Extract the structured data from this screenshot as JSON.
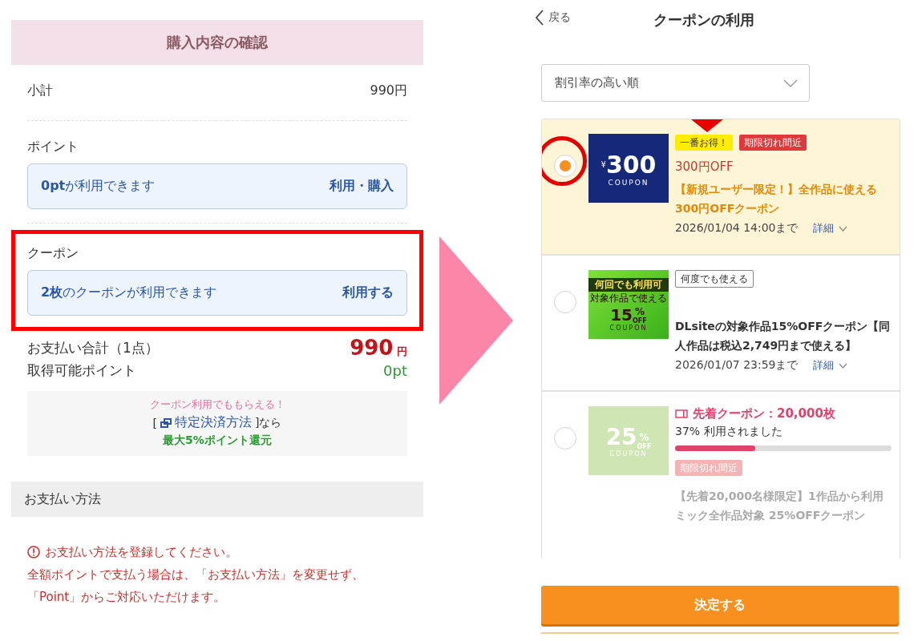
{
  "checkout": {
    "title": "購入内容の確認",
    "subtotal": {
      "label": "小計",
      "value": "990円"
    },
    "points": {
      "label": "ポイント",
      "text": "**0pt**が利用できます",
      "action": "利用・購入"
    },
    "coupon": {
      "label": "クーポン",
      "text": "**2枚**のクーポンが利用できます",
      "action": "利用する",
      "highlighted": true
    },
    "total": {
      "label": "お支払い合計（1点）",
      "amount": "990",
      "unit": "円"
    },
    "earn": {
      "label": "取得可能ポイント",
      "value": "0pt"
    },
    "promo": {
      "headline": "クーポン利用でももらえる！",
      "open": "[",
      "link": "特定決済方法",
      "close": "]なら",
      "reward": "最大5%ポイント還元"
    },
    "payment": {
      "title": "お支払い方法",
      "error": "お支払い方法を登録してください。",
      "note": "全額ポイントで支払う場合は、「お支払い方法」を変更せず、「Point」からご対応いただけます。"
    }
  },
  "coupon_screen": {
    "back": "戻る",
    "title": "クーポンの利用",
    "sort": "割引率の高い順",
    "coupons": [
      {
        "kind": "featured",
        "selected": true,
        "circled": true,
        "thumb": {
          "kind": "yen",
          "symbol": "¥",
          "number": "300",
          "label": "COUPON"
        },
        "badges": [
          {
            "kind": "best",
            "label": "一番お得！",
            "arrow_marked": true
          },
          {
            "kind": "expiring",
            "label": "期限切れ間近",
            "arrow_marked": false
          }
        ],
        "discount": "300円OFF",
        "title": "【新規ユーザー限定！】全作品に使える300円OFFクーポン",
        "expires": "2026/01/04 14:00まで",
        "details": "詳細"
      },
      {
        "kind": "normal",
        "selected": false,
        "circled": false,
        "thumb": {
          "kind": "percent_green",
          "top": "何回でも利用可",
          "caption": "対象作品で使える",
          "number": "15",
          "unit": "%",
          "off": "OFF",
          "label": "COUPON"
        },
        "badges": [
          {
            "kind": "reusable",
            "label": "何度でも使える",
            "arrow_marked": false
          }
        ],
        "title": "DLsiteの対象作品15%OFFクーポン【同人作品は税込2,749円まで使える】",
        "expires": "2026/01/07 23:59まで",
        "details": "詳細"
      },
      {
        "kind": "limited",
        "selected": false,
        "circled": false,
        "thumb": {
          "kind": "percent_pale",
          "number": "25",
          "unit": "%",
          "off": "OFF",
          "label": "COUPON"
        },
        "stock": {
          "label": "先着クーポン：20,000枚",
          "reading": "37% 利用されました",
          "level": 0.37
        },
        "badges": [
          {
            "kind": "expiring",
            "label": "期限切れ間近",
            "arrow_marked": false
          }
        ],
        "title": "【先着20,000名様限定】1作品から利用ミック全作品対象 25%OFFクーポン"
      }
    ],
    "confirm": "決定する"
  }
}
